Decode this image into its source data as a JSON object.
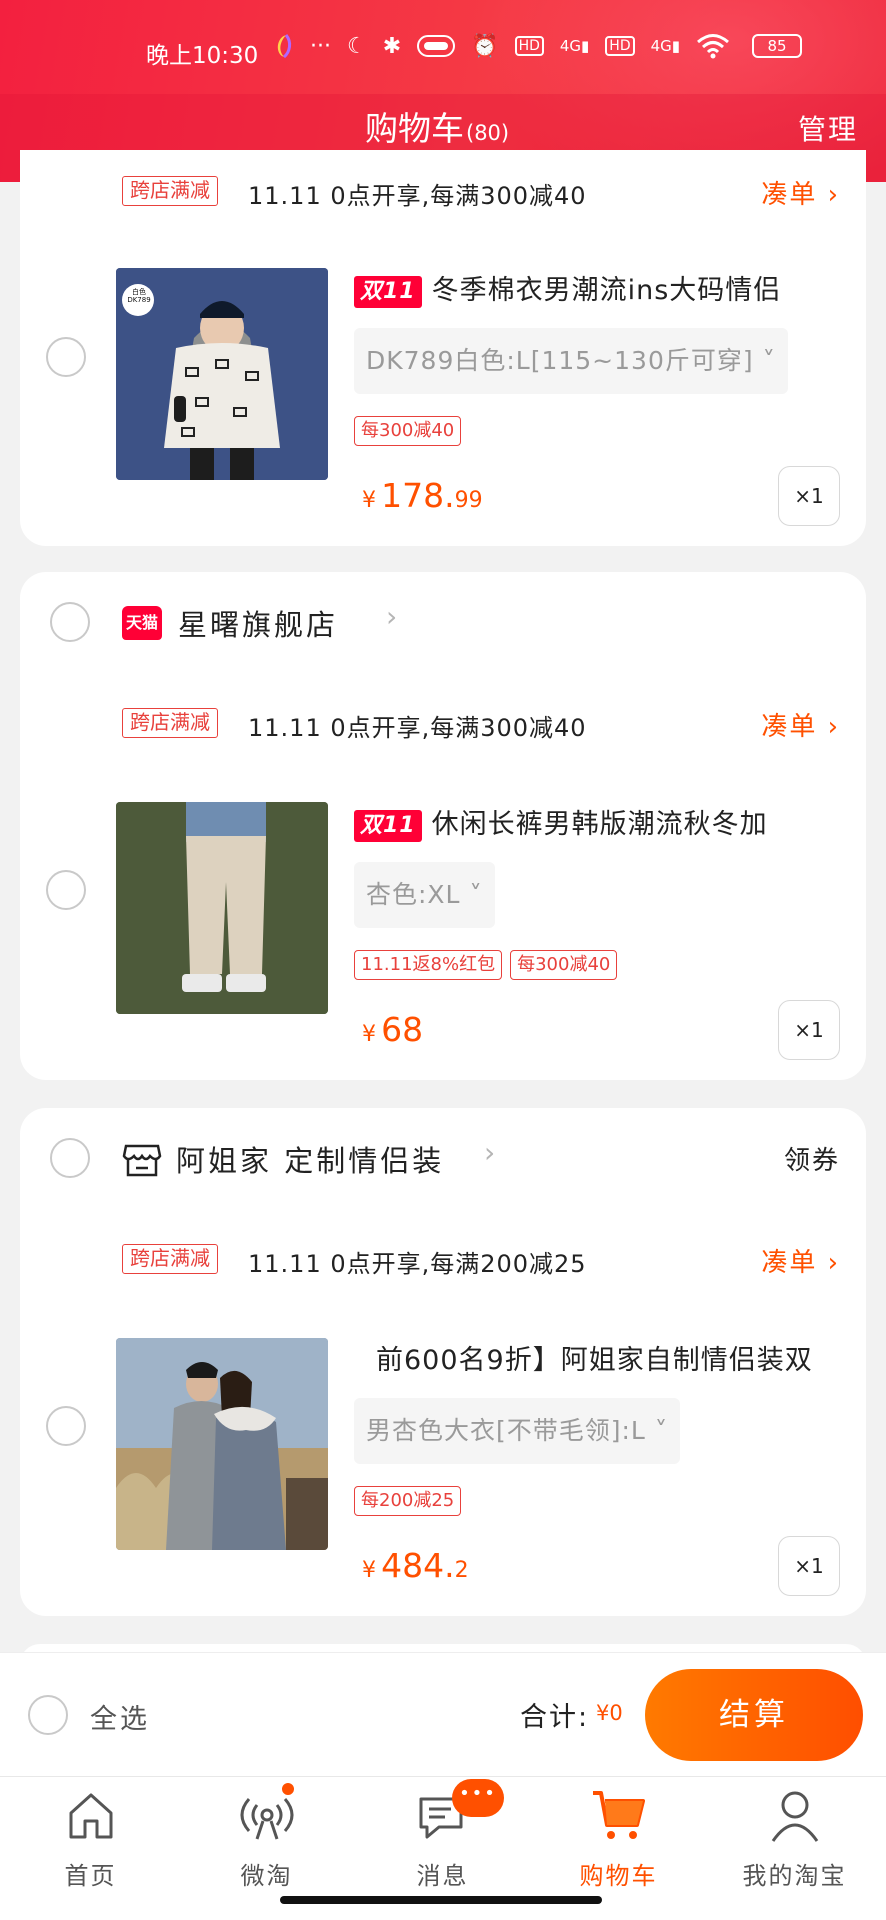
{
  "status_bar": {
    "time": "晚上10:30",
    "icons": [
      "app-icon",
      "more-dots",
      "moon-icon",
      "bluetooth-icon",
      "nfc-icon",
      "alarm-icon",
      "hd-icon",
      "4g-signal-icon",
      "hd-icon",
      "4g-signal-icon",
      "wifi-icon"
    ],
    "battery": "85",
    "more_dots": "···",
    "moon": "☾",
    "bluetooth": "✱",
    "alarm": "⏰",
    "hd": "HD",
    "signal": "4G▮"
  },
  "header": {
    "title": "购物车",
    "count": "(80)",
    "manage": "管理"
  },
  "cards": [
    {
      "promo_tag": "跨店满减",
      "promo_text": "11.11 0点开享,每满300减40",
      "promo_link": "凑单 ›",
      "product": {
        "badge": "双11",
        "title": "冬季棉衣男潮流ins大码情侣",
        "sku": "DK789白色:L[115~130斤可穿] ˅",
        "tags": [
          "每300减40"
        ],
        "price_currency": "¥",
        "price_int": "178.",
        "price_dec": "99",
        "qty": "×1",
        "thumb_label": "白色 DK789"
      }
    },
    {
      "store_badge": "天猫",
      "store_name": "星曙旗舰店",
      "store_chevron": "›",
      "promo_tag": "跨店满减",
      "promo_text": "11.11 0点开享,每满300减40",
      "promo_link": "凑单 ›",
      "product": {
        "badge": "双11",
        "title": "休闲长裤男韩版潮流秋冬加",
        "sku": "杏色:XL ˅",
        "tags": [
          "11.11返8%红包",
          "每300减40"
        ],
        "price_currency": "¥",
        "price_int": "68",
        "price_dec": "",
        "qty": "×1"
      }
    },
    {
      "store_name": "阿姐家 定制情侣装",
      "store_chevron": "›",
      "store_action": "领券",
      "promo_tag": "跨店满减",
      "promo_text": "11.11 0点开享,每满200减25",
      "promo_link": "凑单 ›",
      "product": {
        "title": "前600名9折】阿姐家自制情侣装双",
        "sku": "男杏色大衣[不带毛领]:L ˅",
        "tags": [
          "每200减25"
        ],
        "price_currency": "¥",
        "price_int": "484.",
        "price_dec": "2",
        "qty": "×1"
      }
    }
  ],
  "summary": {
    "select_all": "全选",
    "total_label": "合计:",
    "total_value": "¥0",
    "checkout": "结算"
  },
  "tabs": [
    {
      "label": "首页",
      "icon": "home-icon"
    },
    {
      "label": "微淘",
      "icon": "weitao-icon"
    },
    {
      "label": "消息",
      "icon": "message-icon",
      "badge": "•••"
    },
    {
      "label": "购物车",
      "icon": "cart-icon",
      "active": true
    },
    {
      "label": "我的淘宝",
      "icon": "profile-icon"
    }
  ],
  "colors": {
    "brand_red": "#f3203f",
    "accent_orange": "#ff5000",
    "tmall_red": "#ff0036"
  }
}
